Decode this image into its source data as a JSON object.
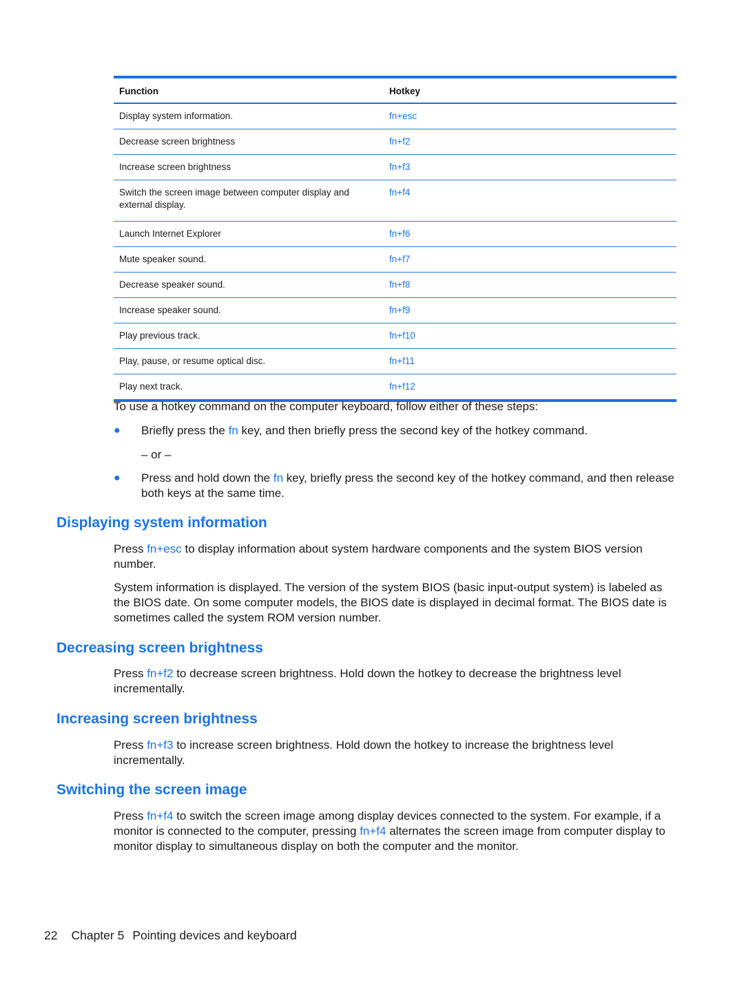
{
  "table": {
    "headers": [
      "Function",
      "Hotkey"
    ],
    "rows": [
      {
        "function": "Display system information.",
        "hotkey": "fn+esc"
      },
      {
        "function": "Decrease screen brightness",
        "hotkey": "fn+f2"
      },
      {
        "function": "Increase screen brightness",
        "hotkey": "fn+f3"
      },
      {
        "function": "Switch the screen image between computer display and external display.",
        "hotkey": "fn+f4"
      },
      {
        "function": "Launch Internet Explorer",
        "hotkey": "fn+f6"
      },
      {
        "function": "Mute speaker sound.",
        "hotkey": "fn+f7"
      },
      {
        "function": "Decrease speaker sound.",
        "hotkey": "fn+f8"
      },
      {
        "function": "Increase speaker sound.",
        "hotkey": "fn+f9"
      },
      {
        "function": "Play previous track.",
        "hotkey": "fn+f10"
      },
      {
        "function": "Play, pause, or resume optical disc.",
        "hotkey": "fn+f11"
      },
      {
        "function": "Play next track.",
        "hotkey": "fn+f12"
      }
    ]
  },
  "intro": {
    "text": "To use a hotkey command on the computer keyboard, follow either of these steps:",
    "bullet1": {
      "pre": "Briefly press the ",
      "key": "fn",
      "post": " key, and then briefly press the second key of the hotkey command."
    },
    "or": "– or –",
    "bullet2": {
      "pre": "Press and hold down the ",
      "key": "fn",
      "post": " key, briefly press the second key of the hotkey command, and then release both keys at the same time."
    }
  },
  "sections": [
    {
      "heading": "Displaying system information",
      "p1": {
        "pre": "Press ",
        "key": "fn+esc",
        "post": " to display information about system hardware components and the system BIOS version number."
      },
      "p2": "System information is displayed. The version of the system BIOS (basic input-output system) is labeled as the BIOS date. On some computer models, the BIOS date is displayed in decimal format. The BIOS date is sometimes called the system ROM version number."
    },
    {
      "heading": "Decreasing screen brightness",
      "p1": {
        "pre": "Press ",
        "key": "fn+f2",
        "post": " to decrease screen brightness. Hold down the hotkey to decrease the brightness level incrementally."
      }
    },
    {
      "heading": "Increasing screen brightness",
      "p1": {
        "pre": "Press ",
        "key": "fn+f3",
        "post": " to increase screen brightness. Hold down the hotkey to increase the brightness level incrementally."
      }
    },
    {
      "heading": "Switching the screen image",
      "p1": {
        "pre": "Press ",
        "key": "fn+f4",
        "mid": " to switch the screen image among display devices connected to the system. For example, if a monitor is connected to the computer, pressing ",
        "key2": "fn+f4",
        "post": " alternates the screen image from computer display to monitor display to simultaneous display on both the computer and the monitor."
      }
    }
  ],
  "footer": {
    "page_number": "22",
    "chapter": "Chapter 5",
    "chapter_title": "Pointing devices and keyboard"
  }
}
